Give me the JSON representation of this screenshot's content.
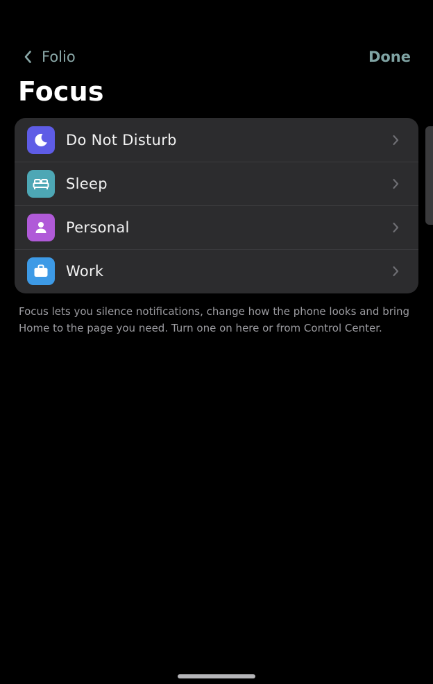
{
  "nav": {
    "back_label": "Folio",
    "done_label": "Done"
  },
  "page": {
    "title": "Focus"
  },
  "focus_modes": [
    {
      "label": "Do Not Disturb",
      "icon": "moon-icon",
      "color": "#5e5ce6"
    },
    {
      "label": "Sleep",
      "icon": "bed-icon",
      "color": "#4da7b5"
    },
    {
      "label": "Personal",
      "icon": "person-icon",
      "color": "#b05ad8"
    },
    {
      "label": "Work",
      "icon": "briefcase-icon",
      "color": "#3d9ae6"
    }
  ],
  "description": "Focus lets you silence notifications, change how the phone looks and bring Home to the page you need. Turn one on here or from Control Center.",
  "colors": {
    "background": "#000000",
    "card": "#2c2c2e",
    "accent": "#7fa3a3"
  }
}
